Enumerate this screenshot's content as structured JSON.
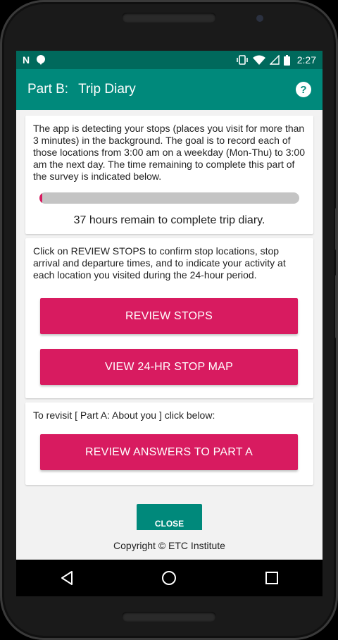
{
  "status_bar": {
    "time": "2:27",
    "left_icons": [
      "n-icon",
      "location-icon"
    ],
    "right_icons": [
      "vibrate-icon",
      "wifi-icon",
      "signal-icon",
      "battery-icon"
    ]
  },
  "app_bar": {
    "part": "Part B:",
    "title": "Trip Diary",
    "help_icon": "help-icon"
  },
  "diary_card": {
    "text": "The app is detecting your stops (places you visit for more than 3 minutes) in the background. The goal is to record each of those locations from 3:00 am on a weekday (Mon-Thu) to 3:00 am the next day. The time remaining to complete this part of the survey is indicated below.",
    "progress_fraction": 0.01,
    "remaining_text": "37 hours remain to complete trip diary."
  },
  "stops_card": {
    "text": "Click on REVIEW STOPS to confirm stop locations, stop arrival and departure times, and to indicate your activity at each location you visited during the 24-hour period.",
    "review_stops_label": "REVIEW STOPS",
    "view_map_label": "VIEW 24-HR STOP MAP"
  },
  "part_a_card": {
    "text": "To revisit [ Part A: About you ] click below:",
    "review_answers_label": "REVIEW ANSWERS TO PART A"
  },
  "close_label": "CLOSE",
  "footer": "Copyright © ETC Institute",
  "nav_bar": [
    "back-icon",
    "home-icon",
    "recents-icon"
  ],
  "colors": {
    "primary": "#00897b",
    "primary_dark": "#00695c",
    "accent": "#d81b60",
    "background": "#f2f2f2"
  }
}
